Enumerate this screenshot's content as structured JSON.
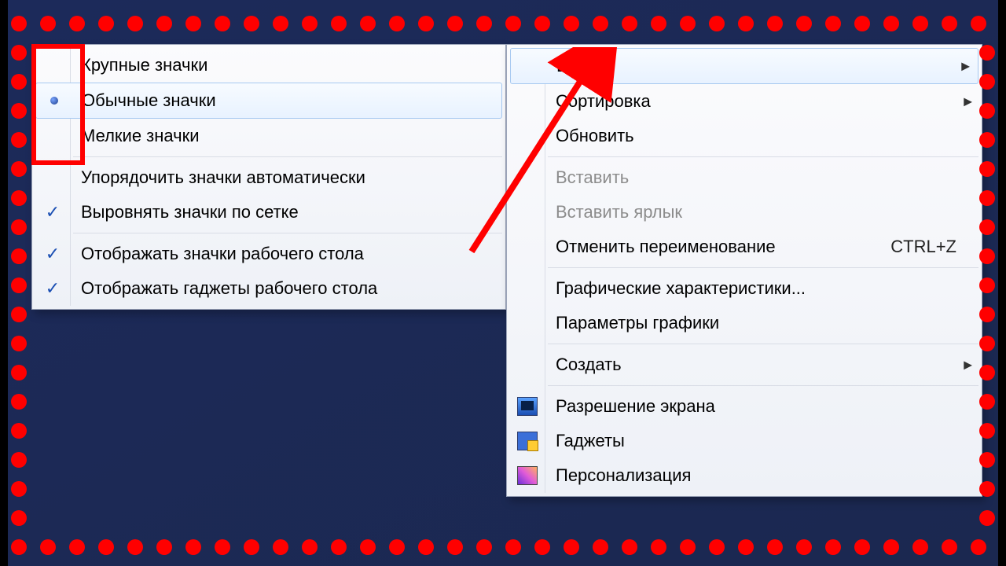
{
  "submenu": {
    "large_icons": "Крупные значки",
    "medium_icons": "Обычные значки",
    "small_icons": "Мелкие значки",
    "auto_arrange": "Упорядочить значки автоматически",
    "align_grid": "Выровнять значки по сетке",
    "show_icons": "Отображать значки рабочего стола",
    "show_gadgets": "Отображать гаджеты  рабочего стола"
  },
  "main": {
    "view": "Вид",
    "sort": "Сортировка",
    "refresh": "Обновить",
    "paste": "Вставить",
    "paste_shortcut": "Вставить ярлык",
    "undo_rename": "Отменить переименование",
    "undo_key": "CTRL+Z",
    "gfx_props": "Графические характеристики...",
    "gfx_params": "Параметры графики",
    "new": "Создать",
    "screen_res": "Разрешение экрана",
    "gadgets": "Гаджеты",
    "personalize": "Персонализация"
  }
}
